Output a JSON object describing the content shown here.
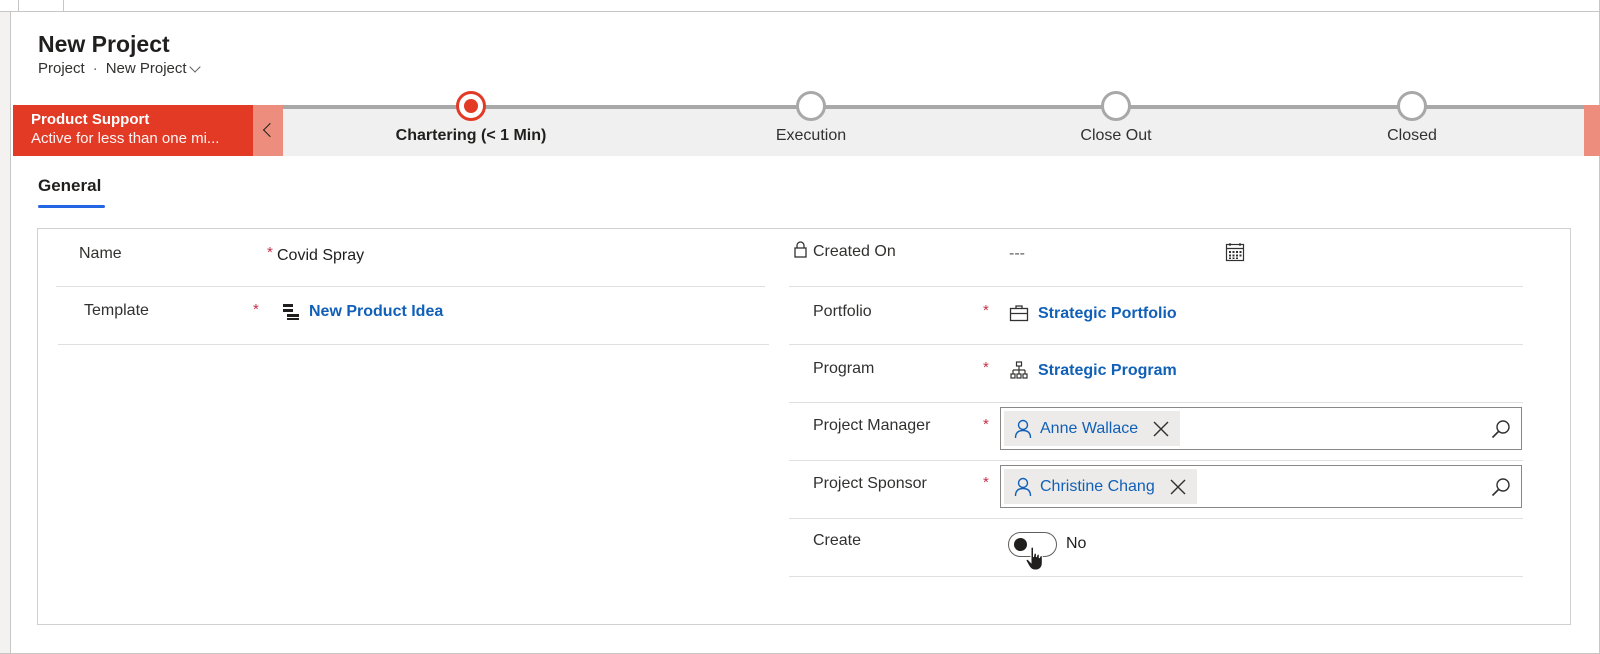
{
  "page": {
    "title": "New Project",
    "breadcrumb": {
      "entity": "Project",
      "separator": "·",
      "form": "New Project"
    }
  },
  "process_flow": {
    "active_stage": {
      "name": "Product Support",
      "status": "Active for less than one mi..."
    },
    "stages": [
      {
        "label": "Chartering  (< 1 Min)",
        "state": "active"
      },
      {
        "label": "Execution",
        "state": "inactive"
      },
      {
        "label": "Close Out",
        "state": "inactive"
      },
      {
        "label": "Closed",
        "state": "inactive"
      }
    ],
    "accent_color": "#e23a25"
  },
  "tabs": [
    {
      "label": "General",
      "selected": true
    }
  ],
  "form": {
    "required_marker": "*",
    "name": {
      "label": "Name",
      "value": "Covid Spray"
    },
    "template": {
      "label": "Template",
      "value": "New Product Idea",
      "icon": "template-icon"
    },
    "created_on": {
      "label": "Created On",
      "value": "---",
      "icon": "calendar-icon"
    },
    "portfolio": {
      "label": "Portfolio",
      "value": "Strategic Portfolio",
      "icon": "briefcase-icon"
    },
    "program": {
      "label": "Program",
      "value": "Strategic Program",
      "icon": "hierarchy-icon"
    },
    "project_manager": {
      "label": "Project Manager",
      "value": "Anne Wallace"
    },
    "project_sponsor": {
      "label": "Project Sponsor",
      "value": "Christine Chang"
    },
    "create": {
      "label": "Create",
      "value": "No",
      "on": false
    }
  },
  "colors": {
    "link": "#1160b7",
    "required": "#c4314b",
    "tab_underline": "#2266e3"
  }
}
